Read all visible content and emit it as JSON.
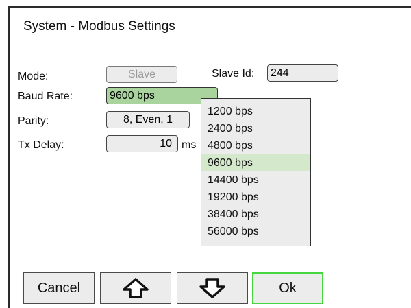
{
  "window": {
    "title": "System - Modbus Settings"
  },
  "form": {
    "mode_label": "Mode:",
    "mode_value": "Slave",
    "slave_id_label": "Slave Id:",
    "slave_id_value": "244",
    "baud_label": "Baud Rate:",
    "baud_value": "9600 bps",
    "parity_label": "Parity:",
    "parity_value": "8, Even, 1",
    "tx_delay_label": "Tx Delay:",
    "tx_delay_value": "10",
    "tx_delay_unit": "ms"
  },
  "dropdown": {
    "options": [
      "1200 bps",
      "2400 bps",
      "4800 bps",
      "9600 bps",
      "14400 bps",
      "19200 bps",
      "38400 bps",
      "56000 bps"
    ],
    "selected": "9600 bps"
  },
  "buttons": {
    "cancel": "Cancel",
    "up_icon": "arrow-up-outline",
    "down_icon": "arrow-down-outline",
    "ok": "Ok"
  },
  "colors": {
    "selected_field": "#a9d49d",
    "selected_option": "#d4e8cc",
    "ok_border": "#46d63f"
  }
}
